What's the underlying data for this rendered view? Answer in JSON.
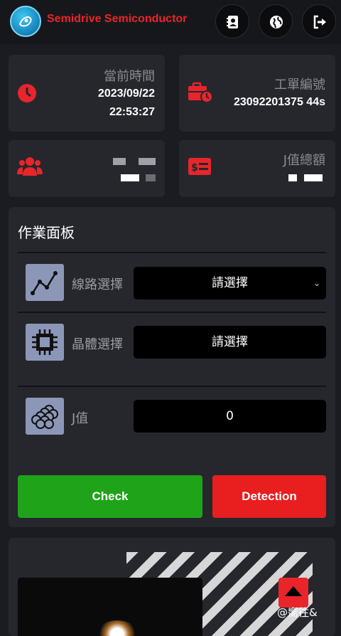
{
  "header": {
    "brand": "Semidrive Semiconductor",
    "buttons": [
      "contacts-icon",
      "globe-icon",
      "logout-icon"
    ]
  },
  "cards": {
    "time": {
      "label": "當前時間",
      "date": "2023/09/22",
      "time": "22:53:27",
      "icon": "clock-icon"
    },
    "order": {
      "label": "工單編號",
      "value": "23092201375 44s",
      "icon": "briefcase-clock-icon"
    },
    "team": {
      "icon": "users-icon"
    },
    "total": {
      "label": "J值總額",
      "icon": "money-card-icon"
    }
  },
  "panel": {
    "title": "作業面板",
    "route": {
      "label": "線路選擇",
      "value": "請選擇",
      "icon": "line-chart-icon"
    },
    "chip": {
      "label": "晶體選擇",
      "value": "請選擇",
      "icon": "chip-icon"
    },
    "jvalue": {
      "label": "J值",
      "value": "0",
      "icon": "spheres-icon"
    },
    "check_label": "Check",
    "detect_label": "Detection"
  },
  "watermark": "@嚮往&",
  "colors": {
    "brand": "#e8252b",
    "check": "#1fa319",
    "detect": "#e81e1f",
    "card": "#26272d",
    "background": "#1b1c21"
  }
}
